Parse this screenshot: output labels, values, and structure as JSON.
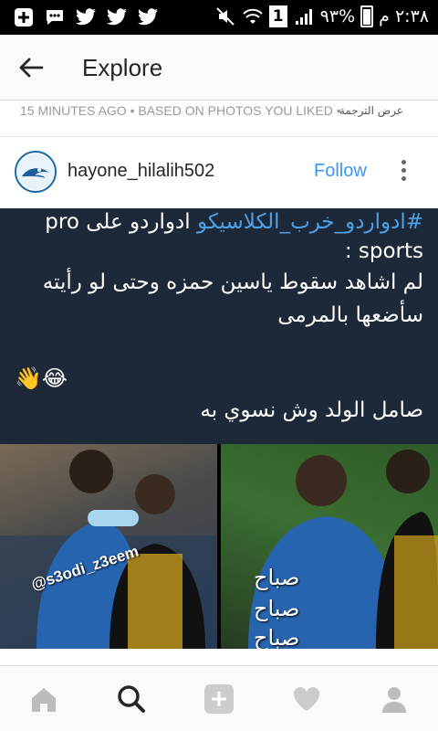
{
  "status_bar": {
    "battery": "٩٣%",
    "time": "٢:٣٨ م",
    "sim": "1"
  },
  "app_bar": {
    "title": "Explore"
  },
  "meta": {
    "text": "15 MINUTES AGO • BASED ON PHOTOS YOU LIKED •",
    "translate": "عرض الترجمة"
  },
  "post": {
    "username": "hayone_hilalih502",
    "follow_label": "Follow",
    "tweet": {
      "line1_link": "#ادواردو_خرب_الكلاسيكو",
      "line1_text": " ادواردو على pro",
      "line2": "sports :",
      "line3": "لم اشاهد سقوط ياسين حمزه وحتى لو رأيته",
      "line4": "سأضعها بالمرمى",
      "emoji": "👋😂",
      "line5": "صامل الولد وش نسوي به"
    },
    "watermark": "@s3odi_z3eem",
    "photo_text": [
      "صباح",
      "صباح",
      "صباح"
    ]
  },
  "bottom_nav": {
    "items": [
      "home-icon",
      "search-icon",
      "add-icon",
      "heart-icon",
      "profile-icon"
    ]
  }
}
